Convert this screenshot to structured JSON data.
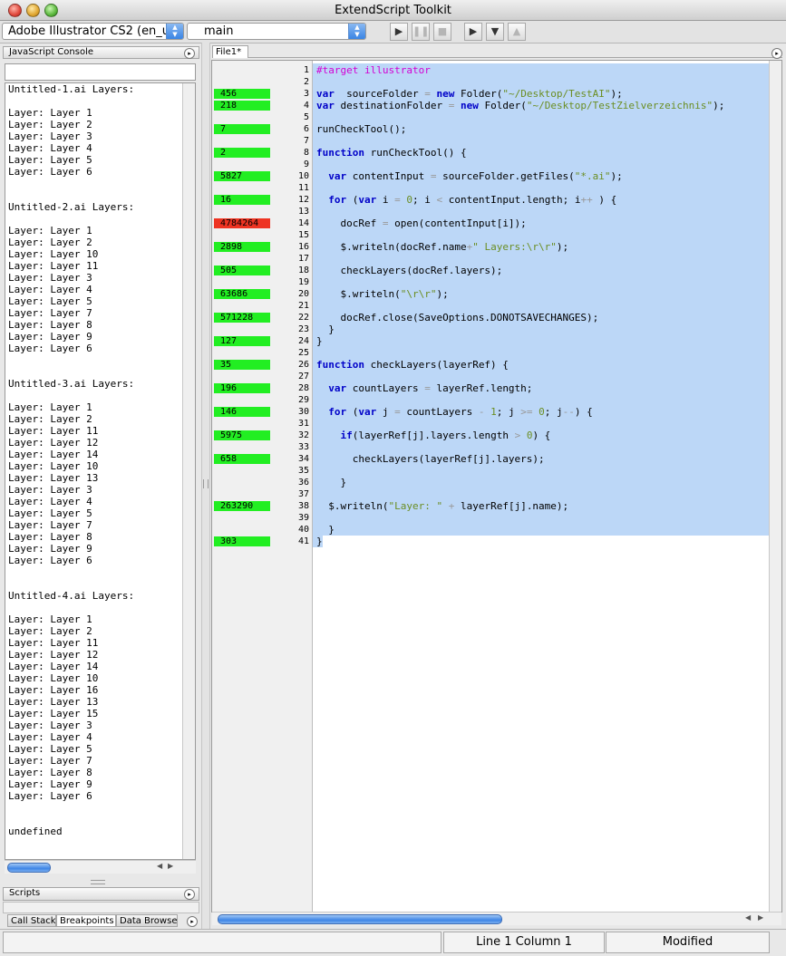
{
  "window": {
    "title": "ExtendScript Toolkit"
  },
  "toolbar": {
    "target_app": "Adobe Illustrator CS2 (en_u",
    "engine": "main",
    "buttons": [
      "run-icon",
      "pause-icon",
      "stop-icon",
      "step-over-icon",
      "step-into-icon",
      "step-out-icon"
    ]
  },
  "left": {
    "console_tab": "JavaScript Console",
    "console_output": "Untitled-1.ai Layers:\n\nLayer: Layer 1\nLayer: Layer 2\nLayer: Layer 3\nLayer: Layer 4\nLayer: Layer 5\nLayer: Layer 6\n\n\nUntitled-2.ai Layers:\n\nLayer: Layer 1\nLayer: Layer 2\nLayer: Layer 10\nLayer: Layer 11\nLayer: Layer 3\nLayer: Layer 4\nLayer: Layer 5\nLayer: Layer 7\nLayer: Layer 8\nLayer: Layer 9\nLayer: Layer 6\n\n\nUntitled-3.ai Layers:\n\nLayer: Layer 1\nLayer: Layer 2\nLayer: Layer 11\nLayer: Layer 12\nLayer: Layer 14\nLayer: Layer 10\nLayer: Layer 13\nLayer: Layer 3\nLayer: Layer 4\nLayer: Layer 5\nLayer: Layer 7\nLayer: Layer 8\nLayer: Layer 9\nLayer: Layer 6\n\n\nUntitled-4.ai Layers:\n\nLayer: Layer 1\nLayer: Layer 2\nLayer: Layer 11\nLayer: Layer 12\nLayer: Layer 14\nLayer: Layer 10\nLayer: Layer 16\nLayer: Layer 13\nLayer: Layer 15\nLayer: Layer 3\nLayer: Layer 4\nLayer: Layer 5\nLayer: Layer 7\nLayer: Layer 8\nLayer: Layer 9\nLayer: Layer 6\n\n\nundefined",
    "scripts_tab": "Scripts",
    "bottom_tabs": [
      "Call Stack",
      "Breakpoints",
      "Data Browser"
    ]
  },
  "editor": {
    "file_tab": "File1*",
    "code_lines": [
      [
        [
          "pre",
          "#target illustrator"
        ]
      ],
      [],
      [
        [
          "kw",
          "var"
        ],
        [
          "",
          "  sourceFolder "
        ],
        [
          "op",
          "="
        ],
        [
          "",
          ""
        ],
        [
          "kw",
          " new"
        ],
        [
          "",
          " Folder("
        ],
        [
          "str",
          "\"~/Desktop/TestAI\""
        ],
        [
          "",
          ");"
        ]
      ],
      [
        [
          "kw",
          "var"
        ],
        [
          "",
          " destinationFolder "
        ],
        [
          "op",
          "="
        ],
        [
          "kw",
          " new"
        ],
        [
          "",
          " Folder("
        ],
        [
          "str",
          "\"~/Desktop/TestZielverzeichnis\""
        ],
        [
          "",
          ");"
        ]
      ],
      [],
      [
        [
          "",
          "runCheckTool();"
        ]
      ],
      [],
      [
        [
          "kw",
          "function"
        ],
        [
          "",
          " runCheckTool() {"
        ]
      ],
      [],
      [
        [
          "",
          "  "
        ],
        [
          "kw",
          "var"
        ],
        [
          "",
          " contentInput "
        ],
        [
          "op",
          "="
        ],
        [
          "",
          " sourceFolder.getFiles("
        ],
        [
          "str",
          "\"*.ai\""
        ],
        [
          "",
          ");"
        ]
      ],
      [],
      [
        [
          "",
          "  "
        ],
        [
          "kw",
          "for"
        ],
        [
          "",
          " ("
        ],
        [
          "kw",
          "var"
        ],
        [
          "",
          " i "
        ],
        [
          "op",
          "="
        ],
        [
          "",
          " "
        ],
        [
          "str",
          "0"
        ],
        [
          "",
          "; i "
        ],
        [
          "op",
          "<"
        ],
        [
          "",
          " contentInput.length; i"
        ],
        [
          "op",
          "++"
        ],
        [
          "",
          " ) {"
        ]
      ],
      [],
      [
        [
          "",
          "    docRef "
        ],
        [
          "op",
          "="
        ],
        [
          "",
          " open(contentInput[i]);"
        ]
      ],
      [],
      [
        [
          "",
          "    $.writeln(docRef.name"
        ],
        [
          "op",
          "+"
        ],
        [
          "str",
          "\" Layers:\\r\\r\""
        ],
        [
          "",
          ");"
        ]
      ],
      [],
      [
        [
          "",
          "    checkLayers(docRef.layers);"
        ]
      ],
      [],
      [
        [
          "",
          "    $.writeln("
        ],
        [
          "str",
          "\"\\r\\r\""
        ],
        [
          "",
          ");"
        ]
      ],
      [],
      [
        [
          "",
          "    docRef.close(SaveOptions.DONOTSAVECHANGES);"
        ]
      ],
      [
        [
          "",
          "  }"
        ]
      ],
      [
        [
          "",
          "}"
        ]
      ],
      [],
      [
        [
          "kw",
          "function"
        ],
        [
          "",
          " checkLayers(layerRef) {"
        ]
      ],
      [],
      [
        [
          "",
          "  "
        ],
        [
          "kw",
          "var"
        ],
        [
          "",
          " countLayers "
        ],
        [
          "op",
          "="
        ],
        [
          "",
          " layerRef.length;"
        ]
      ],
      [],
      [
        [
          "",
          "  "
        ],
        [
          "kw",
          "for"
        ],
        [
          "",
          " ("
        ],
        [
          "kw",
          "var"
        ],
        [
          "",
          " j "
        ],
        [
          "op",
          "="
        ],
        [
          "",
          " countLayers "
        ],
        [
          "op",
          "-"
        ],
        [
          "",
          " "
        ],
        [
          "str",
          "1"
        ],
        [
          "",
          "; j "
        ],
        [
          "op",
          ">="
        ],
        [
          "",
          " "
        ],
        [
          "str",
          "0"
        ],
        [
          "",
          "; j"
        ],
        [
          "op",
          "--"
        ],
        [
          "",
          ") {"
        ]
      ],
      [],
      [
        [
          "",
          "    "
        ],
        [
          "kw",
          "if"
        ],
        [
          "",
          "(layerRef[j].layers.length "
        ],
        [
          "op",
          ">"
        ],
        [
          "",
          " "
        ],
        [
          "str",
          "0"
        ],
        [
          "",
          ") {"
        ]
      ],
      [],
      [
        [
          "",
          "      checkLayers(layerRef[j].layers);"
        ]
      ],
      [],
      [
        [
          "",
          "    }"
        ]
      ],
      [],
      [
        [
          "",
          "  $.writeln("
        ],
        [
          "str",
          "\"Layer: \""
        ],
        [
          "",
          " "
        ],
        [
          "op",
          "+"
        ],
        [
          "",
          " layerRef[j].name);"
        ]
      ],
      [],
      [
        [
          "",
          "  }"
        ]
      ],
      [
        [
          "",
          "}"
        ]
      ]
    ],
    "line_numbers": [
      "1",
      "2",
      "3",
      "4",
      "5",
      "6",
      "7",
      "8",
      "9",
      "10",
      "11",
      "12",
      "13",
      "14",
      "15",
      "16",
      "17",
      "18",
      "19",
      "20",
      "21",
      "22",
      "23",
      "24",
      "25",
      "26",
      "27",
      "28",
      "29",
      "30",
      "31",
      "32",
      "33",
      "34",
      "35",
      "36",
      "37",
      "38",
      "39",
      "40",
      "41"
    ],
    "profiler": [
      {
        "line": 3,
        "value": "456",
        "color": "#22ee22"
      },
      {
        "line": 4,
        "value": "218",
        "color": "#22ee22"
      },
      {
        "line": 6,
        "value": "7",
        "color": "#22ee22"
      },
      {
        "line": 8,
        "value": "2",
        "color": "#22ee22"
      },
      {
        "line": 10,
        "value": "5827",
        "color": "#22ee22"
      },
      {
        "line": 12,
        "value": "16",
        "color": "#22ee22"
      },
      {
        "line": 14,
        "value": "4784264",
        "color": "#ee3322"
      },
      {
        "line": 16,
        "value": "2898",
        "color": "#22ee22"
      },
      {
        "line": 18,
        "value": "505",
        "color": "#22ee22"
      },
      {
        "line": 20,
        "value": "63686",
        "color": "#22ee22"
      },
      {
        "line": 22,
        "value": "571228",
        "color": "#22ee22"
      },
      {
        "line": 24,
        "value": "127",
        "color": "#22ee22"
      },
      {
        "line": 26,
        "value": "35",
        "color": "#22ee22"
      },
      {
        "line": 28,
        "value": "196",
        "color": "#22ee22"
      },
      {
        "line": 30,
        "value": "146",
        "color": "#22ee22"
      },
      {
        "line": 32,
        "value": "5975",
        "color": "#22ee22"
      },
      {
        "line": 34,
        "value": "658",
        "color": "#22ee22"
      },
      {
        "line": 38,
        "value": "263290",
        "color": "#22ee22"
      },
      {
        "line": 41,
        "value": "303",
        "color": "#22ee22"
      }
    ]
  },
  "status": {
    "position": "Line 1 Column 1",
    "state": "Modified"
  }
}
